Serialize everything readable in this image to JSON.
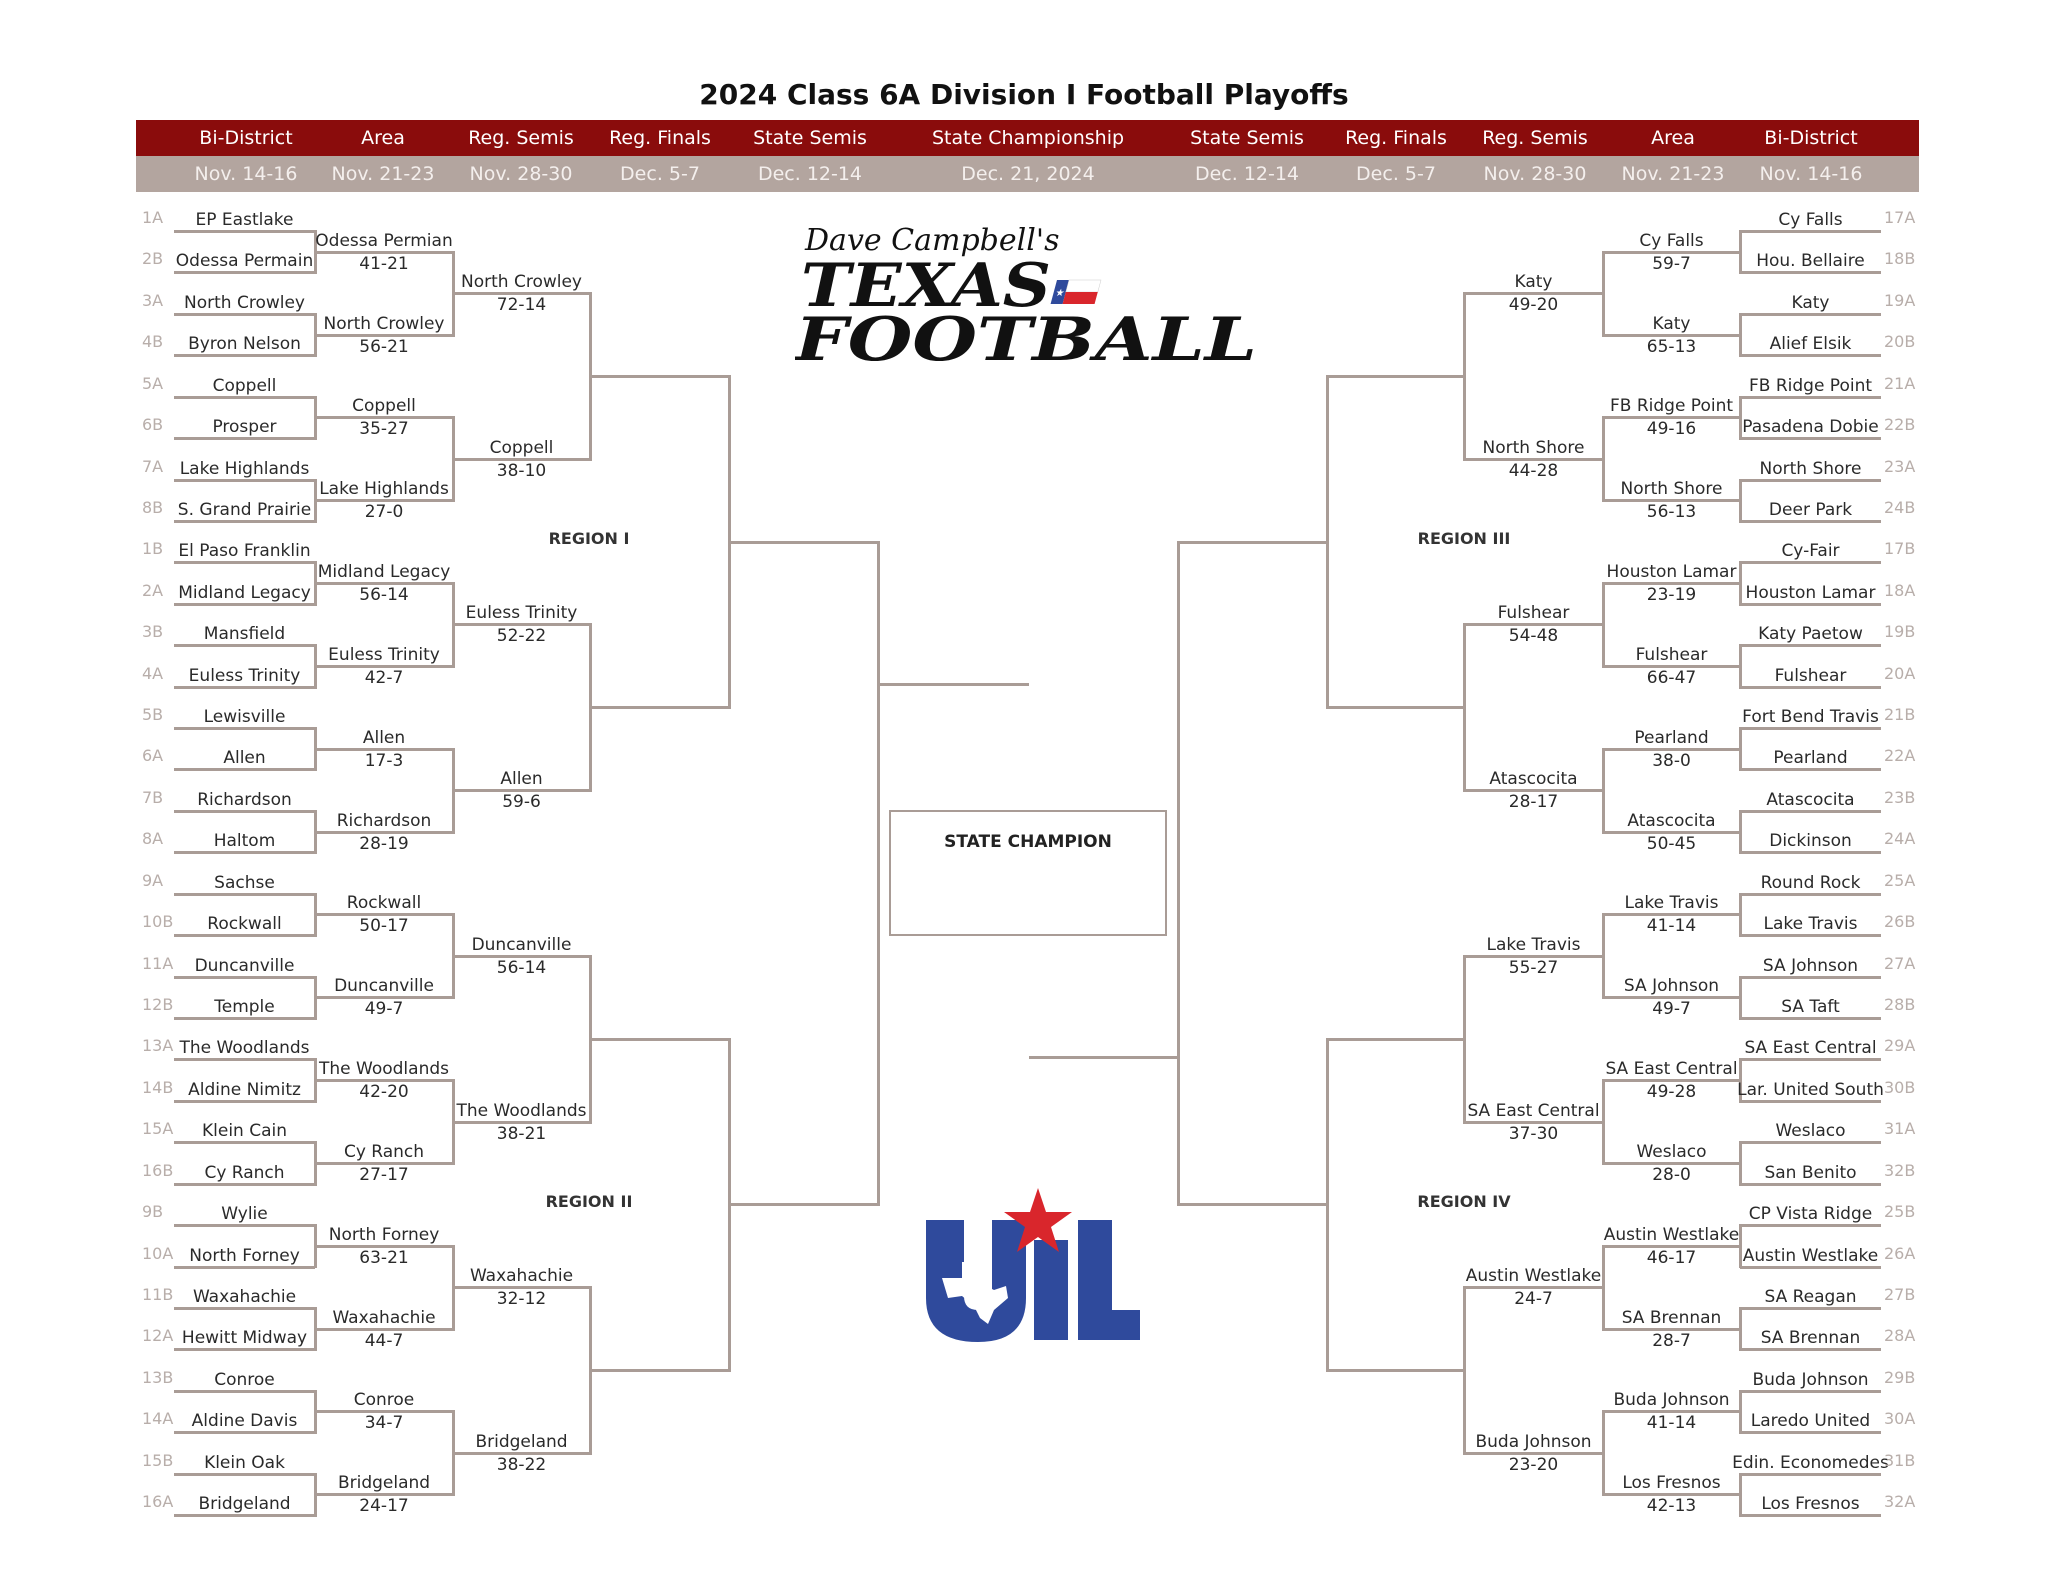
{
  "title": "2024 Class 6A Division I Football Playoffs",
  "colors": {
    "header_red": "#8a0c0c",
    "header_gray": "#b3a59f",
    "bracket_line": "#a99c96",
    "uil_blue": "#2f4a9c",
    "uil_red": "#d9262c"
  },
  "rounds": [
    {
      "name": "Bi-District",
      "dates": "Nov. 14-16"
    },
    {
      "name": "Area",
      "dates": "Nov. 21-23"
    },
    {
      "name": "Reg. Semis",
      "dates": "Nov. 28-30"
    },
    {
      "name": "Reg. Finals",
      "dates": "Dec. 5-7"
    },
    {
      "name": "State Semis",
      "dates": "Dec. 12-14"
    },
    {
      "name": "State Championship",
      "dates": "Dec. 21, 2024"
    },
    {
      "name": "State Semis",
      "dates": "Dec. 12-14"
    },
    {
      "name": "Reg. Finals",
      "dates": "Dec. 5-7"
    },
    {
      "name": "Reg. Semis",
      "dates": "Nov. 28-30"
    },
    {
      "name": "Area",
      "dates": "Nov. 21-23"
    },
    {
      "name": "Bi-District",
      "dates": "Nov. 14-16"
    }
  ],
  "regions": [
    "REGION I",
    "REGION II",
    "REGION III",
    "REGION IV"
  ],
  "state_champion_label": "STATE CHAMPION",
  "logos": {
    "texas_football": [
      "Dave Campbell's",
      "TEXAS",
      "FOOTBALL"
    ],
    "uil": "UIL"
  },
  "left": {
    "round1": [
      {
        "seed": "1A",
        "team": "EP Eastlake"
      },
      {
        "seed": "2B",
        "team": "Odessa Permain"
      },
      {
        "seed": "3A",
        "team": "North Crowley"
      },
      {
        "seed": "4B",
        "team": "Byron Nelson"
      },
      {
        "seed": "5A",
        "team": "Coppell"
      },
      {
        "seed": "6B",
        "team": "Prosper"
      },
      {
        "seed": "7A",
        "team": "Lake Highlands"
      },
      {
        "seed": "8B",
        "team": "S. Grand Prairie"
      },
      {
        "seed": "1B",
        "team": "El Paso Franklin"
      },
      {
        "seed": "2A",
        "team": "Midland Legacy"
      },
      {
        "seed": "3B",
        "team": "Mansfield"
      },
      {
        "seed": "4A",
        "team": "Euless Trinity"
      },
      {
        "seed": "5B",
        "team": "Lewisville"
      },
      {
        "seed": "6A",
        "team": "Allen"
      },
      {
        "seed": "7B",
        "team": "Richardson"
      },
      {
        "seed": "8A",
        "team": "Haltom"
      },
      {
        "seed": "9A",
        "team": "Sachse"
      },
      {
        "seed": "10B",
        "team": "Rockwall"
      },
      {
        "seed": "11A",
        "team": "Duncanville"
      },
      {
        "seed": "12B",
        "team": "Temple"
      },
      {
        "seed": "13A",
        "team": "The Woodlands"
      },
      {
        "seed": "14B",
        "team": "Aldine Nimitz"
      },
      {
        "seed": "15A",
        "team": "Klein Cain"
      },
      {
        "seed": "16B",
        "team": "Cy Ranch"
      },
      {
        "seed": "9B",
        "team": "Wylie"
      },
      {
        "seed": "10A",
        "team": "North Forney"
      },
      {
        "seed": "11B",
        "team": "Waxahachie"
      },
      {
        "seed": "12A",
        "team": "Hewitt Midway"
      },
      {
        "seed": "13B",
        "team": "Conroe"
      },
      {
        "seed": "14A",
        "team": "Aldine Davis"
      },
      {
        "seed": "15B",
        "team": "Klein Oak"
      },
      {
        "seed": "16A",
        "team": "Bridgeland"
      }
    ],
    "round2": [
      {
        "team": "Odessa Permian",
        "score": "41-21"
      },
      {
        "team": "North Crowley",
        "score": "56-21"
      },
      {
        "team": "Coppell",
        "score": "35-27"
      },
      {
        "team": "Lake Highlands",
        "score": "27-0"
      },
      {
        "team": "Midland Legacy",
        "score": "56-14"
      },
      {
        "team": "Euless Trinity",
        "score": "42-7"
      },
      {
        "team": "Allen",
        "score": "17-3"
      },
      {
        "team": "Richardson",
        "score": "28-19"
      },
      {
        "team": "Rockwall",
        "score": "50-17"
      },
      {
        "team": "Duncanville",
        "score": "49-7"
      },
      {
        "team": "The Woodlands",
        "score": "42-20"
      },
      {
        "team": "Cy Ranch",
        "score": "27-17"
      },
      {
        "team": "North Forney",
        "score": "63-21"
      },
      {
        "team": "Waxahachie",
        "score": "44-7"
      },
      {
        "team": "Conroe",
        "score": "34-7"
      },
      {
        "team": "Bridgeland",
        "score": "24-17"
      }
    ],
    "round3": [
      {
        "team": "North Crowley",
        "score": "72-14"
      },
      {
        "team": "Coppell",
        "score": "38-10"
      },
      {
        "team": "Euless Trinity",
        "score": "52-22"
      },
      {
        "team": "Allen",
        "score": "59-6"
      },
      {
        "team": "Duncanville",
        "score": "56-14"
      },
      {
        "team": "The Woodlands",
        "score": "38-21"
      },
      {
        "team": "Waxahachie",
        "score": "32-12"
      },
      {
        "team": "Bridgeland",
        "score": "38-22"
      }
    ]
  },
  "right": {
    "round1": [
      {
        "seed": "17A",
        "team": "Cy Falls"
      },
      {
        "seed": "18B",
        "team": "Hou. Bellaire"
      },
      {
        "seed": "19A",
        "team": "Katy"
      },
      {
        "seed": "20B",
        "team": "Alief Elsik"
      },
      {
        "seed": "21A",
        "team": "FB Ridge Point"
      },
      {
        "seed": "22B",
        "team": "Pasadena Dobie"
      },
      {
        "seed": "23A",
        "team": "North Shore"
      },
      {
        "seed": "24B",
        "team": "Deer Park"
      },
      {
        "seed": "17B",
        "team": "Cy-Fair"
      },
      {
        "seed": "18A",
        "team": "Houston Lamar"
      },
      {
        "seed": "19B",
        "team": "Katy Paetow"
      },
      {
        "seed": "20A",
        "team": "Fulshear"
      },
      {
        "seed": "21B",
        "team": "Fort Bend Travis"
      },
      {
        "seed": "22A",
        "team": "Pearland"
      },
      {
        "seed": "23B",
        "team": "Atascocita"
      },
      {
        "seed": "24A",
        "team": "Dickinson"
      },
      {
        "seed": "25A",
        "team": "Round Rock"
      },
      {
        "seed": "26B",
        "team": "Lake Travis"
      },
      {
        "seed": "27A",
        "team": "SA Johnson"
      },
      {
        "seed": "28B",
        "team": "SA Taft"
      },
      {
        "seed": "29A",
        "team": "SA East Central"
      },
      {
        "seed": "30B",
        "team": "Lar. United South"
      },
      {
        "seed": "31A",
        "team": "Weslaco"
      },
      {
        "seed": "32B",
        "team": "San Benito"
      },
      {
        "seed": "25B",
        "team": "CP Vista Ridge"
      },
      {
        "seed": "26A",
        "team": "Austin Westlake"
      },
      {
        "seed": "27B",
        "team": "SA Reagan"
      },
      {
        "seed": "28A",
        "team": "SA Brennan"
      },
      {
        "seed": "29B",
        "team": "Buda Johnson"
      },
      {
        "seed": "30A",
        "team": "Laredo United"
      },
      {
        "seed": "31B",
        "team": "Edin. Economedes"
      },
      {
        "seed": "32A",
        "team": "Los Fresnos"
      }
    ],
    "round2": [
      {
        "team": "Cy Falls",
        "score": "59-7"
      },
      {
        "team": "Katy",
        "score": "65-13"
      },
      {
        "team": "FB Ridge Point",
        "score": "49-16"
      },
      {
        "team": "North Shore",
        "score": "56-13"
      },
      {
        "team": "Houston Lamar",
        "score": "23-19"
      },
      {
        "team": "Fulshear",
        "score": "66-47"
      },
      {
        "team": "Pearland",
        "score": "38-0"
      },
      {
        "team": "Atascocita",
        "score": "50-45"
      },
      {
        "team": "Lake Travis",
        "score": "41-14"
      },
      {
        "team": "SA Johnson",
        "score": "49-7"
      },
      {
        "team": "SA East Central",
        "score": "49-28"
      },
      {
        "team": "Weslaco",
        "score": "28-0"
      },
      {
        "team": "Austin Westlake",
        "score": "46-17"
      },
      {
        "team": "SA Brennan",
        "score": "28-7"
      },
      {
        "team": "Buda Johnson",
        "score": "41-14"
      },
      {
        "team": "Los Fresnos",
        "score": "42-13"
      }
    ],
    "round3": [
      {
        "team": "Katy",
        "score": "49-20"
      },
      {
        "team": "North Shore",
        "score": "44-28"
      },
      {
        "team": "Fulshear",
        "score": "54-48"
      },
      {
        "team": "Atascocita",
        "score": "28-17"
      },
      {
        "team": "Lake Travis",
        "score": "55-27"
      },
      {
        "team": "SA East Central",
        "score": "37-30"
      },
      {
        "team": "Austin Westlake",
        "score": "24-7"
      },
      {
        "team": "Buda Johnson",
        "score": "23-20"
      }
    ]
  }
}
